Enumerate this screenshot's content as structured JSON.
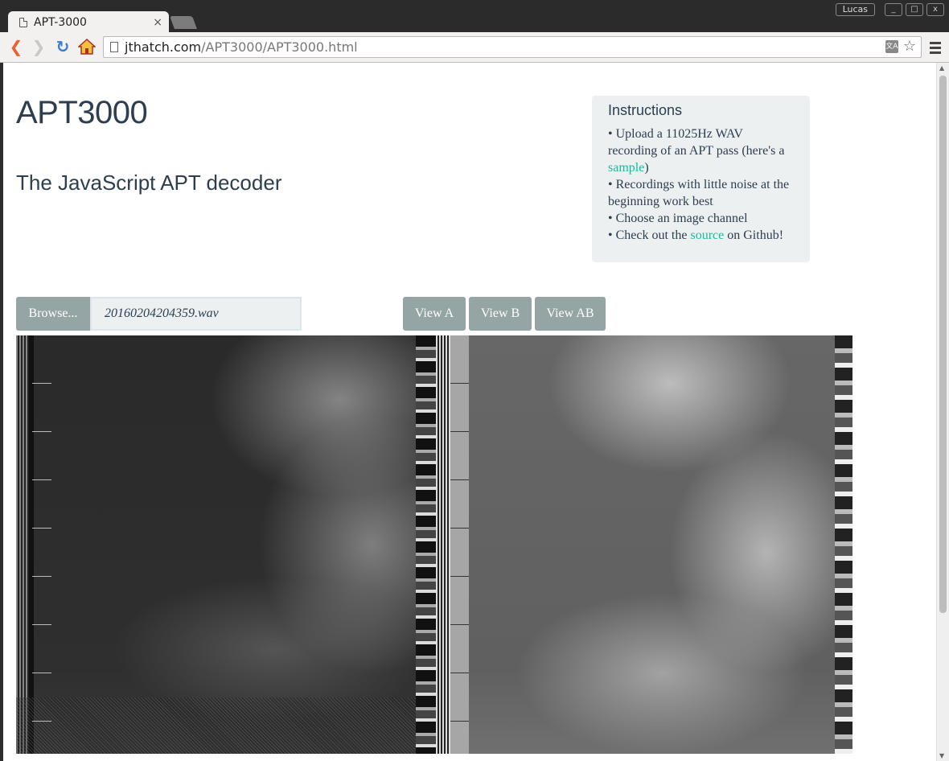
{
  "browser": {
    "tab_title": "APT-3000",
    "tab_close": "×",
    "user": "Lucas",
    "url_domain": "jthatch.com",
    "url_path": "/APT3000/APT3000.html",
    "translate_glyph": "文A",
    "window_controls": {
      "minimize": "_",
      "maximize": "□",
      "close": "x"
    }
  },
  "page": {
    "title": "APT3000",
    "subtitle": "The JavaScript APT decoder",
    "instructions": {
      "heading": "Instructions",
      "item1_pre": "Upload a 11025Hz WAV recording of an APT pass (here's a ",
      "item1_link": "sample",
      "item1_post": ")",
      "item2": "Recordings with little noise at the beginning work best",
      "item3": "Choose an image channel",
      "item4_pre": "Check out the ",
      "item4_link": "source",
      "item4_post": " on Github!"
    },
    "controls": {
      "browse_label": "Browse...",
      "file_name": "20160204204359.wav",
      "view_a": "View A",
      "view_b": "View B",
      "view_ab": "View AB"
    }
  },
  "colors": {
    "primary_text": "#2c3e50",
    "link": "#18bc9c",
    "button": "#95a5a6",
    "panel": "#ecf0f1"
  }
}
